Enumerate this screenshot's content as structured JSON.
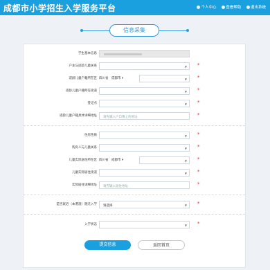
{
  "header": {
    "title": "成都市小学招生入学服务平台",
    "links": [
      "个人中心",
      "查看帮助",
      "退出系统"
    ]
  },
  "section": {
    "title": "信息采集"
  },
  "form": {
    "rows": [
      {
        "label": "学生基本信息",
        "type": "readonly"
      },
      {
        "label": "户主与适龄儿童关系",
        "type": "select",
        "required": true
      },
      {
        "label": "适龄儿童户籍所在区",
        "type": "region",
        "province": "四川省",
        "city": "成都市",
        "required": true
      },
      {
        "label": "适龄儿童户籍所在街道",
        "type": "select",
        "required": true
      },
      {
        "label": "登记点",
        "type": "select",
        "required": true
      },
      {
        "label": "适龄儿童户籍具体详细地址",
        "type": "text",
        "placeholder": "请先输入户口簿上的地址",
        "required": true
      },
      {
        "label": "住房性质",
        "type": "select",
        "required": true
      },
      {
        "label": "购房人与儿童关系",
        "type": "select",
        "required": true
      },
      {
        "label": "儿童实际居住所在区",
        "type": "region",
        "province": "四川省",
        "city": "成都市",
        "required": true
      },
      {
        "label": "儿童实际居住街道",
        "type": "select",
        "required": true
      },
      {
        "label": "实际居住详细地址",
        "type": "text",
        "placeholder": "请先输入居住地址",
        "required": true
      },
      {
        "label": "是否就近（本港澳）随迁入学",
        "type": "select",
        "value": "请选择",
        "required": true
      },
      {
        "label": "入学状态",
        "type": "select",
        "required": true
      }
    ]
  },
  "buttons": {
    "submit": "提交信息",
    "back": "返回首页"
  }
}
